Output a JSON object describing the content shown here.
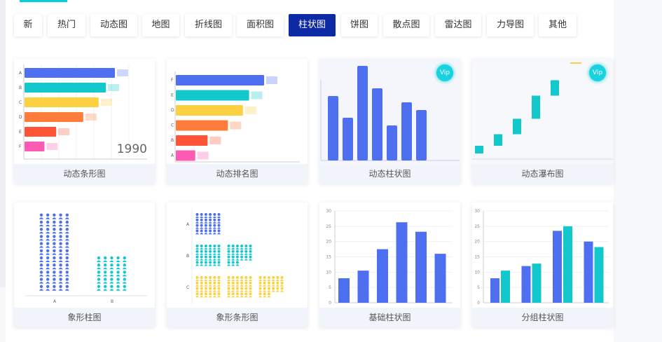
{
  "tabs": [
    {
      "label": "新",
      "active": false
    },
    {
      "label": "热门",
      "active": false
    },
    {
      "label": "动态图",
      "active": false
    },
    {
      "label": "地图",
      "active": false
    },
    {
      "label": "折线图",
      "active": false
    },
    {
      "label": "面积图",
      "active": false
    },
    {
      "label": "柱状图",
      "active": true
    },
    {
      "label": "饼图",
      "active": false
    },
    {
      "label": "散点图",
      "active": false
    },
    {
      "label": "雷达图",
      "active": false
    },
    {
      "label": "力导图",
      "active": false
    },
    {
      "label": "其他",
      "active": false
    }
  ],
  "cards": [
    {
      "title": "动态条形图",
      "vip": false
    },
    {
      "title": "动态排名图",
      "vip": false
    },
    {
      "title": "动态柱状图",
      "vip": true
    },
    {
      "title": "动态瀑布图",
      "vip": true
    },
    {
      "title": "象形柱图",
      "vip": false
    },
    {
      "title": "象形条形图",
      "vip": false
    },
    {
      "title": "基础柱状图",
      "vip": false
    },
    {
      "title": "分组柱状图",
      "vip": false
    }
  ],
  "vip_label": "Vip",
  "colors": {
    "accent": "#0d29a4",
    "cyan": "#00d2e0",
    "blue": "#4e6ff0",
    "teal": "#13c8cd",
    "yellow": "#fcd13f",
    "orange": "#ff7c3a",
    "red": "#ff5437",
    "pink": "#fb5bb3"
  },
  "chart_data": [
    {
      "type": "bar",
      "orientation": "horizontal",
      "categories": [
        "A",
        "B",
        "C",
        "D",
        "E",
        "F"
      ],
      "values": [
        100,
        90,
        82,
        65,
        35,
        22
      ],
      "annotation": "1990"
    },
    {
      "type": "bar",
      "orientation": "horizontal",
      "categories": [
        "F",
        "E",
        "D",
        "C",
        "B",
        "A"
      ],
      "values": [
        100,
        83,
        76,
        59,
        36,
        22
      ]
    },
    {
      "type": "bar",
      "values": [
        92,
        61,
        135,
        103,
        50,
        83,
        72
      ]
    },
    {
      "type": "bar",
      "subtype": "waterfall",
      "values": [
        10,
        15,
        20,
        30,
        20
      ]
    },
    {
      "type": "bar",
      "subtype": "pictorial",
      "categories": [
        "A",
        "B"
      ],
      "values": [
        7,
        3
      ]
    },
    {
      "type": "bar",
      "subtype": "pictorial-horizontal",
      "categories": [
        "A",
        "B",
        "C"
      ],
      "values": [
        3,
        5,
        8
      ]
    },
    {
      "type": "bar",
      "ylim": [
        0,
        30
      ],
      "yticks": [
        0,
        5,
        10,
        15,
        20,
        25,
        30
      ],
      "values": [
        8,
        10.5,
        17.5,
        26.3,
        23.2,
        16
      ]
    },
    {
      "type": "bar",
      "ylim": [
        0,
        30
      ],
      "yticks": [
        0,
        5,
        10,
        15,
        20,
        25,
        30
      ],
      "series": [
        {
          "values": [
            8,
            12,
            23.5,
            20
          ]
        },
        {
          "values": [
            10.5,
            12.8,
            25,
            18.2
          ]
        }
      ]
    }
  ]
}
